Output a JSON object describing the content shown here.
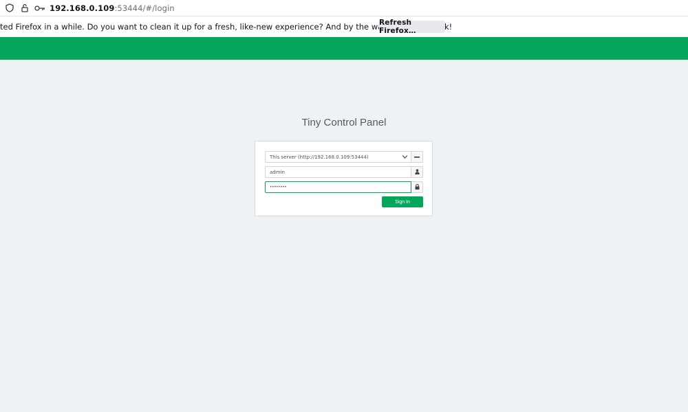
{
  "browser": {
    "url_host": "192.168.0.109",
    "url_rest": ":53444/#/login"
  },
  "notification": {
    "message": "ted Firefox in a while. Do you want to clean it up for a fresh, like-new experience? And by the way, welcome back!",
    "button_label": "Refresh Firefox…"
  },
  "login": {
    "title": "Tiny Control Panel",
    "server_select_value": "This server (http://192.168.0.109:53444)",
    "username_value": "admin",
    "password_value": "••••••••",
    "sign_in_label": "Sign In"
  },
  "colors": {
    "accent": "#03a65a",
    "background": "#eff2f5"
  },
  "icons": {
    "shield": "shield-icon",
    "permissions": "permissions-icon",
    "key": "key-icon",
    "chevron": "chevron-down-icon",
    "minus": "minus-icon",
    "user": "user-icon",
    "lock": "lock-icon"
  }
}
